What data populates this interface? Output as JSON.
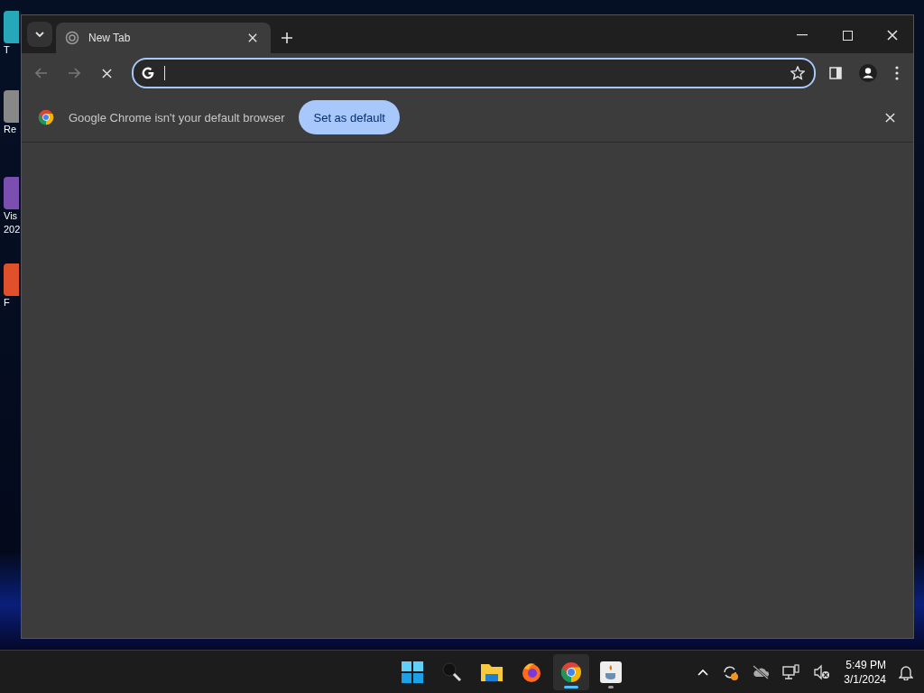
{
  "desktop_icons": [
    {
      "lines": [
        "T"
      ]
    },
    {
      "lines": [
        "Re"
      ]
    },
    {
      "lines": [
        "Vis",
        "202"
      ]
    },
    {
      "lines": [
        "F"
      ]
    }
  ],
  "browser": {
    "tabs": [
      {
        "title": "New Tab",
        "selected": true
      }
    ],
    "nav": {
      "back_disabled": true,
      "forward_disabled": true,
      "loading": true
    },
    "omnibox": {
      "focused": true
    },
    "infobar": {
      "message": "Google Chrome isn't your default browser",
      "button": "Set as default"
    }
  },
  "taskbar": {
    "apps": [
      {
        "kind": "start",
        "running": false,
        "active": false
      },
      {
        "kind": "search",
        "running": false,
        "active": false
      },
      {
        "kind": "files",
        "running": false,
        "active": false
      },
      {
        "kind": "firefox",
        "running": false,
        "active": false
      },
      {
        "kind": "chrome",
        "running": true,
        "active": true
      },
      {
        "kind": "java",
        "running": true,
        "active": false
      }
    ],
    "time": "5:49 PM",
    "date": "3/1/2024"
  }
}
